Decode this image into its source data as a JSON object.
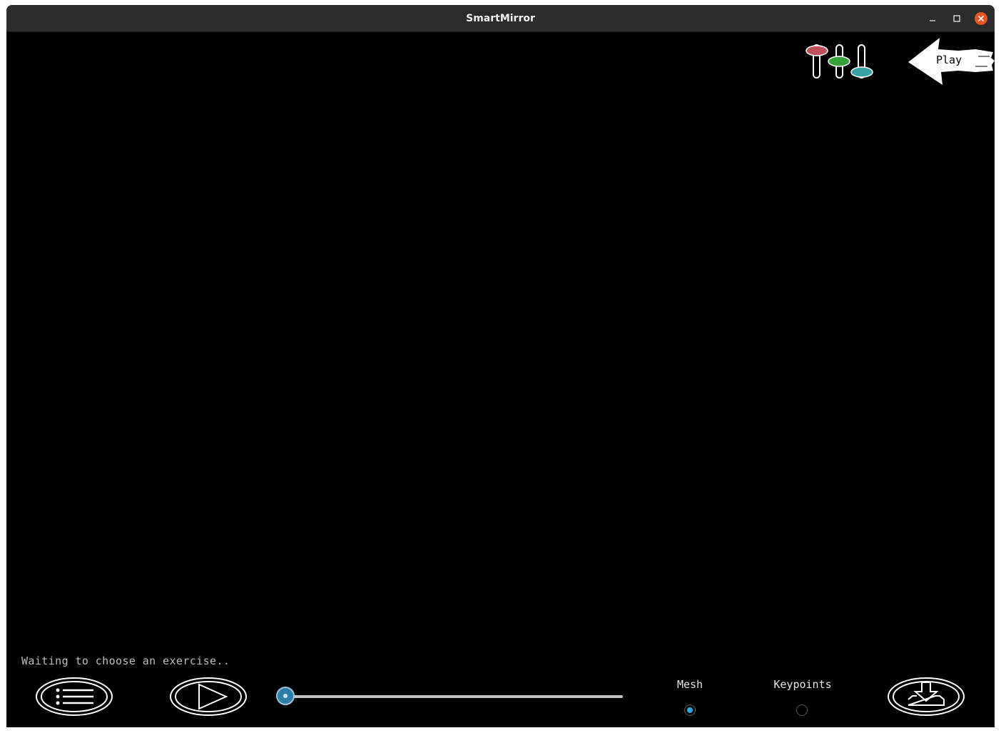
{
  "window": {
    "title": "SmartMirror"
  },
  "titlebar_buttons": {
    "minimize_icon": "minimize-icon",
    "maximize_icon": "maximize-icon",
    "close_icon": "close-icon",
    "close_color": "#e95420"
  },
  "toolbar": {
    "settings_icon": "equalizer-sliders-icon",
    "slider_colors": [
      "#c0505a",
      "#37a33a",
      "#3aa0a8"
    ],
    "play_hint_label": "Play",
    "play_hint_icon": "arrow-left-icon"
  },
  "status": {
    "message": "Waiting to choose an exercise.."
  },
  "controls": {
    "menu_icon": "list-icon",
    "play_icon": "play-icon",
    "download_icon": "download-icon",
    "progress": 0,
    "accent": "#2c7ea8"
  },
  "display_mode": {
    "options": [
      {
        "label": "Mesh",
        "selected": true
      },
      {
        "label": "Keypoints",
        "selected": false
      }
    ]
  }
}
